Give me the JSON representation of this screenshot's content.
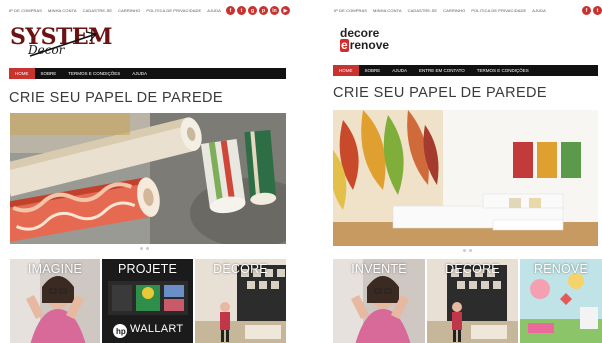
{
  "left_site": {
    "top_links": [
      "IP DE COMPRAS",
      "MINHA CONTA",
      "CADASTRE-SE",
      "CARRINHO",
      "POLITICA DE PRIVACIDADE",
      "AJUDA"
    ],
    "social_icons": [
      "facebook-icon",
      "twitter-icon",
      "google-plus-icon",
      "pinterest-icon",
      "linkedin-icon",
      "youtube-icon"
    ],
    "logo_text": "SYSTEM",
    "logo_script": "Decor",
    "nav": [
      "HOME",
      "SOBRE",
      "TERMOS E CONDIÇÕES",
      "AJUDA"
    ],
    "headline": "CRIE SEU PAPEL DE PAREDE",
    "tiles": [
      "IMAGINE",
      "PROJETE",
      "DECORE"
    ],
    "wallart_badge": "WALLART"
  },
  "right_site": {
    "top_links": [
      "IP DE COMPRAS",
      "MINHA CONTA",
      "CADASTRE-SE",
      "CARRINHO",
      "POLITICA DE PRIVACIDADE",
      "AJUDA"
    ],
    "social_icons": [
      "facebook-icon",
      "twitter-icon"
    ],
    "logo_line1": "decore",
    "logo_line2_e": "e",
    "logo_line2_rest": "renove",
    "nav": [
      "HOME",
      "SOBRE",
      "AJUDA",
      "ENTRE EM CONTATO",
      "TERMOS E CONDIÇÕES"
    ],
    "headline": "CRIE SEU PAPEL DE PAREDE",
    "tiles": [
      "INVENTE",
      "DECORE",
      "RENOVE"
    ]
  },
  "colors": {
    "accent_red": "#c8322f",
    "nav_black": "#111111",
    "logo_maroon": "#6b1212"
  }
}
